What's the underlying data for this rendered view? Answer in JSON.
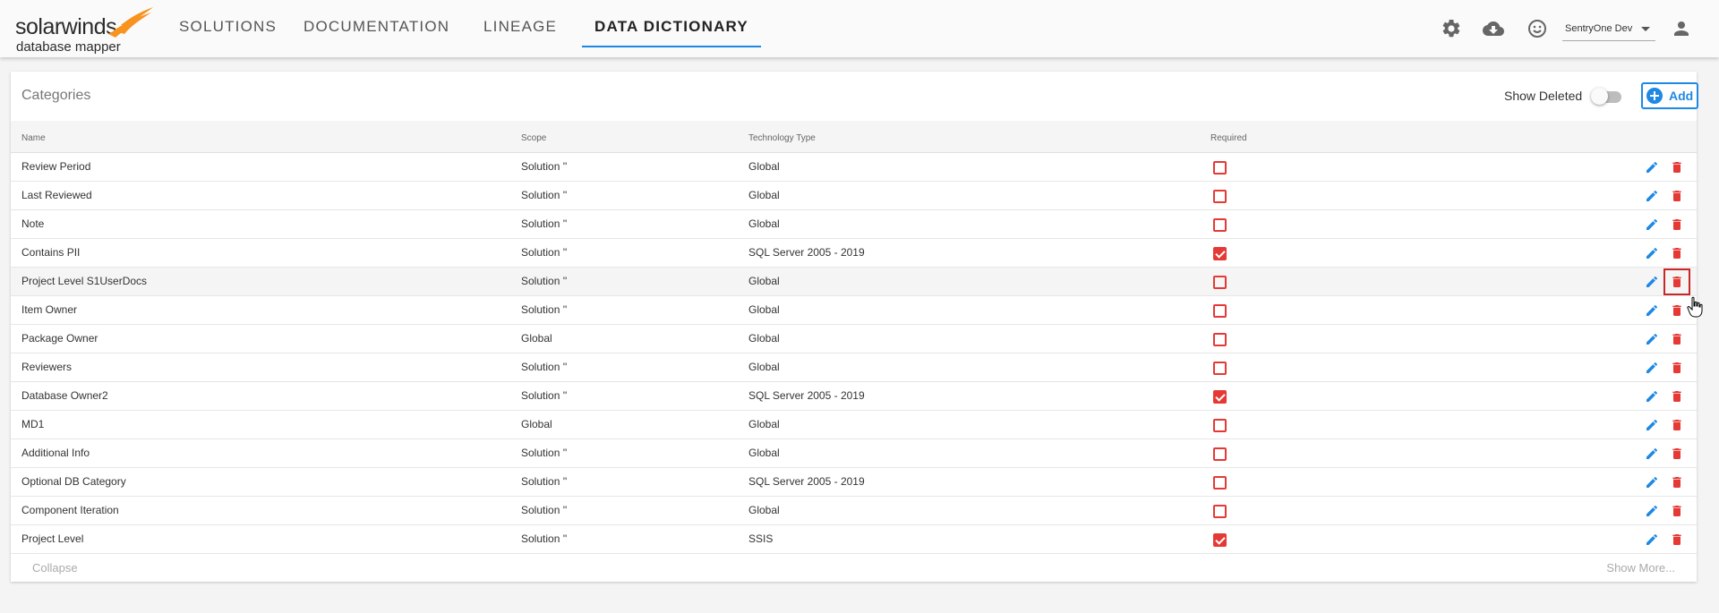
{
  "brand": {
    "name": "solarwinds",
    "product": "database mapper"
  },
  "nav": {
    "items": [
      {
        "label": "SOLUTIONS",
        "active": false
      },
      {
        "label": "DOCUMENTATION",
        "active": false
      },
      {
        "label": "LINEAGE",
        "active": false
      },
      {
        "label": "DATA DICTIONARY",
        "active": true
      }
    ]
  },
  "header_tools": {
    "icons": [
      "gear-icon",
      "cloud-download-icon",
      "smiley-icon",
      "account-icon"
    ],
    "user_select": "SentryOne Dev"
  },
  "card": {
    "title": "Categories",
    "show_deleted_label": "Show Deleted",
    "show_deleted_on": false,
    "add_label": "Add"
  },
  "table": {
    "columns": [
      "Name",
      "Scope",
      "Technology Type",
      "Required"
    ],
    "rows": [
      {
        "name": "Review Period",
        "scope": "Solution ''",
        "tech": "Global",
        "required": false
      },
      {
        "name": "Last Reviewed",
        "scope": "Solution ''",
        "tech": "Global",
        "required": false
      },
      {
        "name": "Note",
        "scope": "Solution ''",
        "tech": "Global",
        "required": false
      },
      {
        "name": "Contains PII",
        "scope": "Solution ''",
        "tech": "SQL Server 2005 - 2019",
        "required": true
      },
      {
        "name": "Project Level S1UserDocs",
        "scope": "Solution ''",
        "tech": "Global",
        "required": false
      },
      {
        "name": "Item Owner",
        "scope": "Solution ''",
        "tech": "Global",
        "required": false
      },
      {
        "name": "Package Owner",
        "scope": "Global",
        "tech": "Global",
        "required": false
      },
      {
        "name": "Reviewers",
        "scope": "Solution ''",
        "tech": "Global",
        "required": false
      },
      {
        "name": "Database Owner2",
        "scope": "Solution ''",
        "tech": "SQL Server 2005 - 2019",
        "required": true
      },
      {
        "name": "MD1",
        "scope": "Global",
        "tech": "Global",
        "required": false
      },
      {
        "name": "Additional Info",
        "scope": "Solution ''",
        "tech": "Global",
        "required": false
      },
      {
        "name": "Optional DB Category",
        "scope": "Solution ''",
        "tech": "SQL Server 2005 - 2019",
        "required": false
      },
      {
        "name": "Component Iteration",
        "scope": "Solution ''",
        "tech": "Global",
        "required": false
      },
      {
        "name": "Project Level",
        "scope": "Solution ''",
        "tech": "SSIS",
        "required": true
      }
    ]
  },
  "footer": {
    "collapse_label": "Collapse",
    "show_more_label": "Show More..."
  },
  "colors": {
    "accent": "#1e88e5",
    "danger": "#e53935",
    "highlight": "#c62828"
  }
}
